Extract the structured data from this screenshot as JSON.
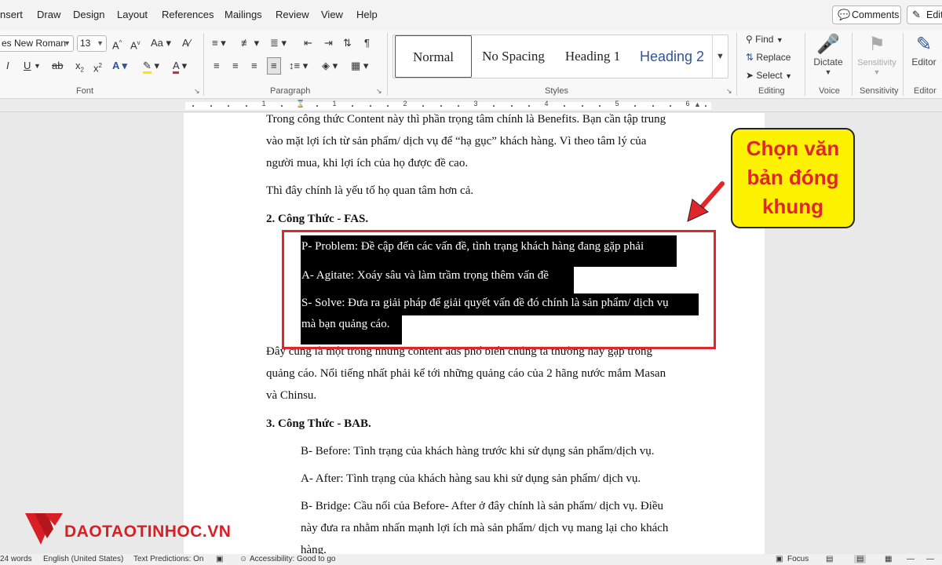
{
  "menu": {
    "tabs": [
      "nsert",
      "Draw",
      "Design",
      "Layout",
      "References",
      "Mailings",
      "Review",
      "View",
      "Help"
    ],
    "comments_label": "Comments",
    "edit_label": "Edit"
  },
  "ribbon": {
    "font_name": "es New Roman",
    "font_size": "13",
    "groups": {
      "font": "Font",
      "paragraph": "Paragraph",
      "styles": "Styles",
      "editing": "Editing",
      "voice": "Voice",
      "sensitivity": "Sensitivity",
      "editor": "Editor"
    },
    "styles": [
      "Normal",
      "No Spacing",
      "Heading 1",
      "Heading 2"
    ],
    "editing": {
      "find": "Find",
      "replace": "Replace",
      "select": "Select"
    },
    "voice_button": "Dictate",
    "sensitivity_button": "Sensitivity",
    "editor_button": "Editor"
  },
  "ruler": {
    "numbers": [
      "1",
      "1",
      "2",
      "3",
      "4",
      "5",
      "6"
    ]
  },
  "document": {
    "line1": "Trong công thức Content này thì phần trọng tâm chính là Benefits. Bạn cần tập trung",
    "line2": "vào mặt lợi ích từ sản phẩm/ dịch vụ để “hạ gục” khách hàng. Vì theo tâm lý của",
    "line3": "người mua, khi lợi ích của họ được đề cao.",
    "line4": "Thì đây chính là yếu tố họ quan tâm hơn cả.",
    "heading_fas": "2. Công Thức - FAS.",
    "fas_p": "P- Problem: Đề cập đến các vấn đề, tình trạng khách hàng đang gặp phải",
    "fas_a": "A- Agitate: Xoáy sâu và làm trầm trọng thêm vấn đề",
    "fas_s1": "S- Solve: Đưa ra giải pháp để giải quyết vấn đề đó chính là sản phẩm/ dịch vụ",
    "fas_s2": "mà bạn quảng cáo.",
    "after1": "Đây cũng là một trong những content ads phổ biến chúng ta thường hay gặp trong",
    "after2": "quảng cáo. Nổi tiếng nhất phải kể tới những quảng cáo của 2 hãng nước mắm Masan",
    "after3": "và Chinsu.",
    "heading_bab": "3. Công Thức - BAB.",
    "bab_b": "B- Before: Tình trạng của khách hàng trước khi sử dụng sản phẩm/dịch vụ.",
    "bab_a": "A- After: Tình trạng của khách hàng sau khi sử dụng sản phẩm/ dịch vụ.",
    "bab_br1": "B- Bridge: Cầu nối của Before- After ở đây chính là sản phẩm/ dịch vụ. Điều",
    "bab_br2": "này đưa ra nhằm nhấn mạnh lợi ích mà sản phẩm/ dịch vụ mang lại cho khách",
    "bab_br3": "hàng."
  },
  "callout": {
    "line1": "Chọn văn",
    "line2": "bản đóng",
    "line3": "khung"
  },
  "statusbar": {
    "words": "24 words",
    "language": "English (United States)",
    "predictions": "Text Predictions: On",
    "accessibility": "Accessibility: Good to go",
    "focus": "Focus"
  },
  "logo": {
    "text": "DAOTAOTINHOC.VN"
  },
  "colors": {
    "highlight_frame": "#e0262b",
    "callout_fill": "#fff200",
    "callout_text": "#e0262b",
    "logo": "#d81f26"
  }
}
